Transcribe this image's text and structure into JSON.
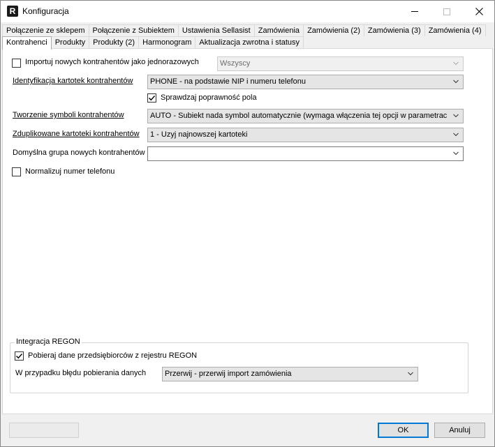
{
  "window": {
    "title": "Konfiguracja",
    "icon": "R"
  },
  "tabs_row1": [
    "Połączenie ze sklepem",
    "Połączenie z Subiektem",
    "Ustawienia Sellasist",
    "Zamówienia",
    "Zamówienia (2)",
    "Zamówienia (3)",
    "Zamówienia (4)"
  ],
  "tabs_row2": [
    "Kontrahenci",
    "Produkty",
    "Produkty (2)",
    "Harmonogram",
    "Aktualizacja zwrotna i statusy"
  ],
  "active_tab": "Kontrahenci",
  "form": {
    "import_once": {
      "label": "Importuj nowych kontrahentów jako jednorazowych",
      "checked": false,
      "combo_value": "Wszyscy"
    },
    "identification": {
      "label": "Identyfikacja kartotek kontrahentów",
      "value": "PHONE - na podstawie NIP i numeru telefonu"
    },
    "validate": {
      "label": "Sprawdzaj poprawność pola",
      "checked": true
    },
    "symbols": {
      "label": "Tworzenie symboli kontrahentów",
      "value": "AUTO - Subiekt nada symbol automatycznie (wymaga włączenia tej opcji w parametrach Su"
    },
    "duplicates": {
      "label": "Zduplikowane kartoteki kontrahentów",
      "value": "1 - Uzyj najnowszej kartoteki"
    },
    "default_group": {
      "label": "Domyślna grupa nowych kontrahentów",
      "value": ""
    },
    "normalize_phone": {
      "label": "Normalizuj numer telefonu",
      "checked": false
    }
  },
  "regon": {
    "legend": "Integracja REGON",
    "fetch": {
      "label": "Pobieraj dane przedsiębiorców z rejestru REGON",
      "checked": true
    },
    "on_error": {
      "label": "W przypadku błędu pobierania danych",
      "value": "Przerwij  - przerwij import zamówienia"
    }
  },
  "buttons": {
    "ok": "OK",
    "cancel": "Anuluj",
    "disabled": ""
  }
}
